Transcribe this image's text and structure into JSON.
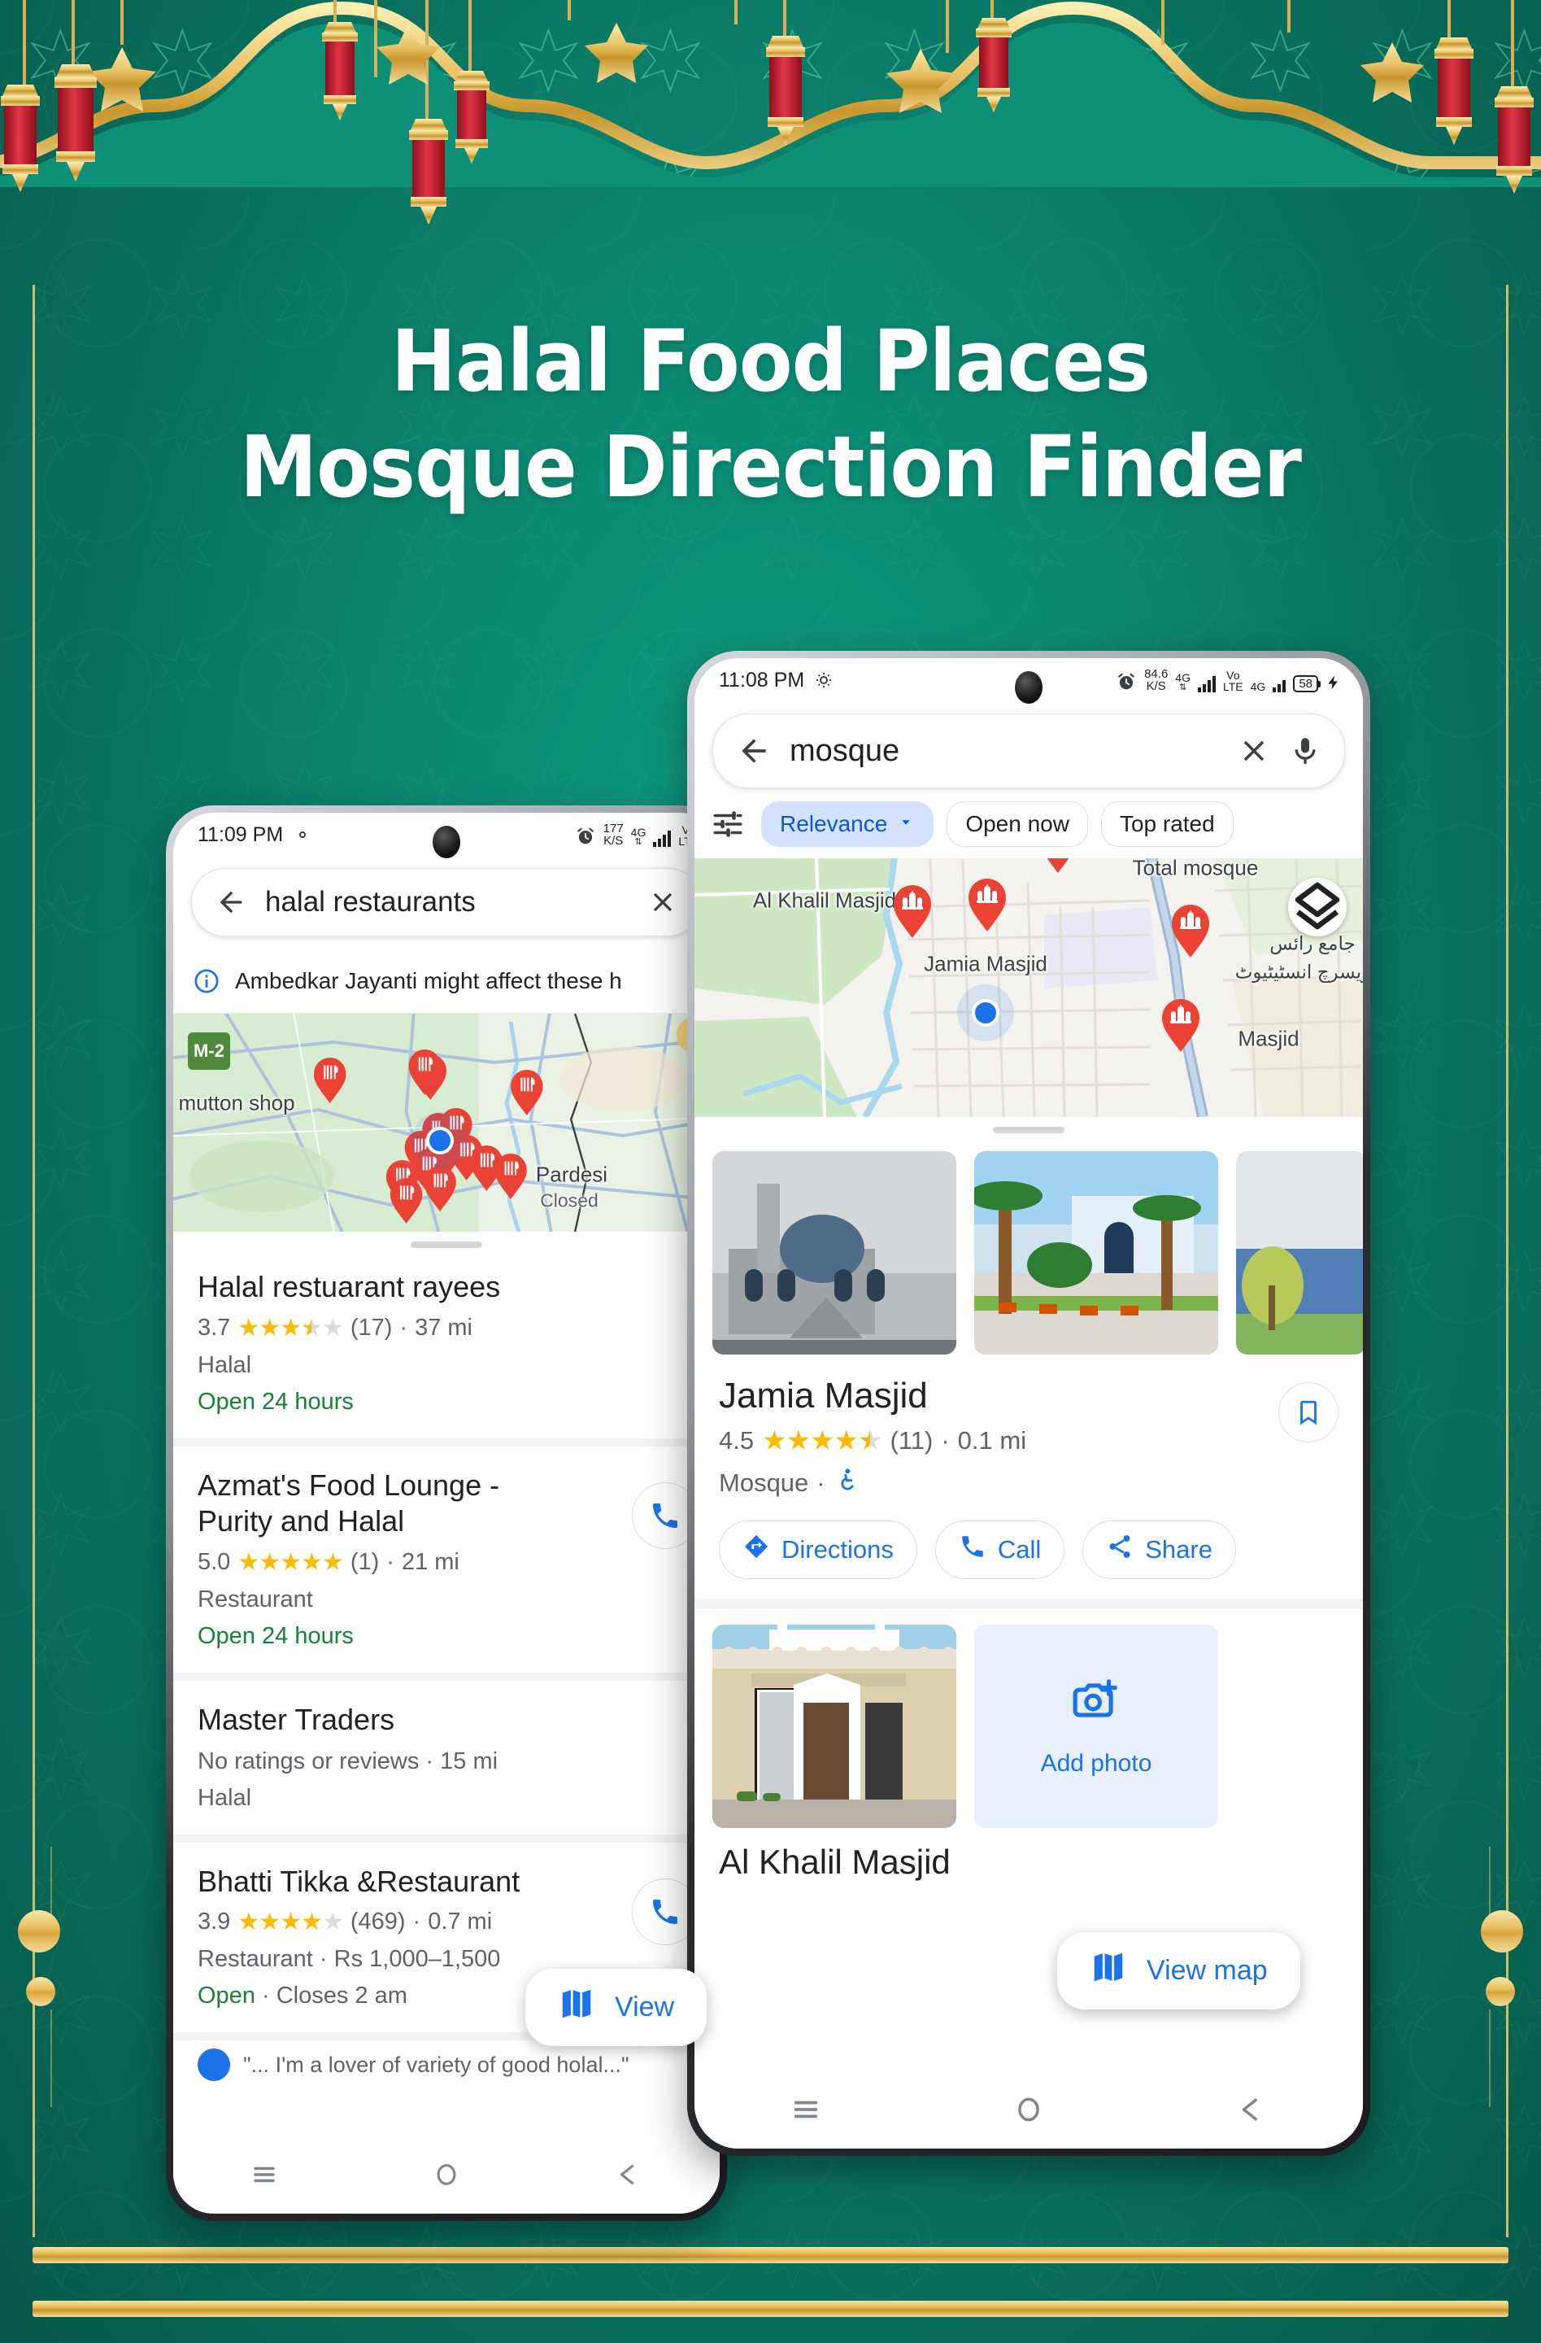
{
  "poster": {
    "title_line1": "Halal Food Places",
    "title_line2": "Mosque Direction Finder",
    "colors": {
      "background_green": "#0b8a73",
      "gold": "#e8c063",
      "lantern_red": "#c42030",
      "accent_blue": "#1a73e8"
    }
  },
  "left_phone": {
    "status_bar": {
      "time": "11:09 PM",
      "gear_icon": "gear-icon",
      "alarm_icon": "alarm-icon",
      "data_rate": "177",
      "data_rate_unit": "K/S",
      "network_1": "4G",
      "volte": "Vo",
      "volte2": "LTE"
    },
    "search": {
      "back_icon": "back-arrow-icon",
      "query": "halal restaurants",
      "clear_icon": "close-icon"
    },
    "banner": {
      "info_icon": "info-icon",
      "text": "Ambedkar Jayanti might affect these h"
    },
    "map": {
      "shield_label": "M-2",
      "labels": [
        {
          "text": "mutton shop"
        },
        {
          "text": "Pardesi"
        },
        {
          "text": "Closed"
        }
      ]
    },
    "results": [
      {
        "name": "Halal restuarant rayees",
        "rating": "3.7",
        "stars_filled": 3,
        "stars_half": true,
        "reviews": "(17)",
        "distance": "37 mi",
        "category": "Halal",
        "status": "Open 24 hours",
        "has_call": false
      },
      {
        "name": "Azmat's Food Lounge - Purity and Halal",
        "rating": "5.0",
        "stars_filled": 5,
        "stars_half": false,
        "reviews": "(1)",
        "distance": "21 mi",
        "category": "Restaurant",
        "status": "Open 24 hours",
        "has_call": true
      },
      {
        "name": "Master Traders",
        "rating": "",
        "stars_filled": 0,
        "stars_half": false,
        "reviews": "",
        "distance": "",
        "no_rating_text": "No ratings or reviews · 15 mi",
        "category": "Halal",
        "status": "",
        "has_call": false
      },
      {
        "name": "Bhatti Tikka &Restaurant",
        "rating": "3.9",
        "stars_filled": 4,
        "stars_half": false,
        "reviews": "(469)",
        "distance": "0.7 mi",
        "category": "Restaurant · Rs 1,000–1,500",
        "status_open": "Open",
        "status": "Open · Closes 2 am",
        "has_call": true
      }
    ],
    "view_map_button": {
      "label": "View",
      "map_icon": "map-icon"
    },
    "nav_bar": {
      "recents_icon": "menu-icon",
      "home_icon": "home-circle-icon",
      "back_icon": "back-triangle-icon"
    }
  },
  "right_phone": {
    "status_bar": {
      "time": "11:08 PM",
      "gear_icon": "gear-icon",
      "alarm_icon": "alarm-icon",
      "data_rate": "84.6",
      "data_rate_unit": "K/S",
      "network_1": "4G",
      "volte": "Vo",
      "volte2": "LTE",
      "network_2": "4G",
      "battery": "58",
      "charging_icon": "bolt-icon"
    },
    "search": {
      "back_icon": "back-arrow-icon",
      "query": "mosque",
      "clear_icon": "close-icon",
      "mic_icon": "microphone-icon"
    },
    "filters": {
      "tune_icon": "tune-icon",
      "chips": [
        {
          "label": "Relevance",
          "active": true,
          "has_caret": true
        },
        {
          "label": "Open now",
          "active": false,
          "has_caret": false
        },
        {
          "label": "Top rated",
          "active": false,
          "has_caret": false
        }
      ]
    },
    "map": {
      "layers_icon": "layers-icon",
      "labels": [
        {
          "text": "Al Khalil Masjid"
        },
        {
          "text": "Jamia Masjid"
        },
        {
          "text": "Total mosque"
        },
        {
          "text": "Masjid"
        },
        {
          "text": "جامع رائس"
        },
        {
          "text": "ریسرچ انسٹیٹیوٹ"
        }
      ]
    },
    "detail": {
      "name": "Jamia Masjid",
      "rating": "4.5",
      "stars_filled": 4,
      "stars_half": true,
      "reviews": "(11)",
      "distance": "0.1 mi",
      "category": "Mosque",
      "accessibility_icon": "wheelchair-icon",
      "save_icon": "bookmark-icon",
      "actions": [
        {
          "label": "Directions",
          "icon": "directions-icon"
        },
        {
          "label": "Call",
          "icon": "phone-icon"
        },
        {
          "label": "Share",
          "icon": "share-icon"
        }
      ]
    },
    "next_result": {
      "name": "Al Khalil Masjid",
      "add_photo_label": "Add photo",
      "add_photo_icon": "add-photo-icon"
    },
    "view_map_button": {
      "label": "View map",
      "map_icon": "map-icon"
    },
    "nav_bar": {
      "recents_icon": "menu-icon",
      "home_icon": "home-circle-icon",
      "back_icon": "back-triangle-icon"
    }
  }
}
